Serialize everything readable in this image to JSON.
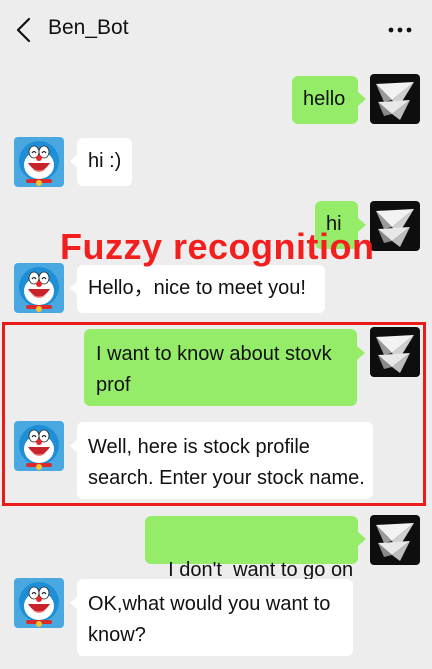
{
  "header": {
    "title": "Ben_Bot",
    "back_icon": "chevron-left-icon",
    "more_icon": "more-dots-icon"
  },
  "annotation": {
    "text": "Fuzzy recognition",
    "color": "#f31f1f"
  },
  "colors": {
    "background": "#ededed",
    "user_bubble": "#95ec69",
    "bot_bubble": "#ffffff",
    "highlight": "#ec1b1b"
  },
  "messages": [
    {
      "sender": "user",
      "text": "hello"
    },
    {
      "sender": "bot",
      "text": "hi :)"
    },
    {
      "sender": "user",
      "text": "hi"
    },
    {
      "sender": "bot",
      "text": "Hello，nice to meet you!"
    },
    {
      "sender": "user",
      "line1": "I want to know about stovk",
      "line2": "prof"
    },
    {
      "sender": "bot",
      "line1": "Well, here is stock profile",
      "line2": "search. Enter your stock name."
    },
    {
      "sender": "user",
      "text": "I don't  want to go on"
    },
    {
      "sender": "bot",
      "line1": "OK,what would you want to",
      "line2": "know?"
    }
  ]
}
